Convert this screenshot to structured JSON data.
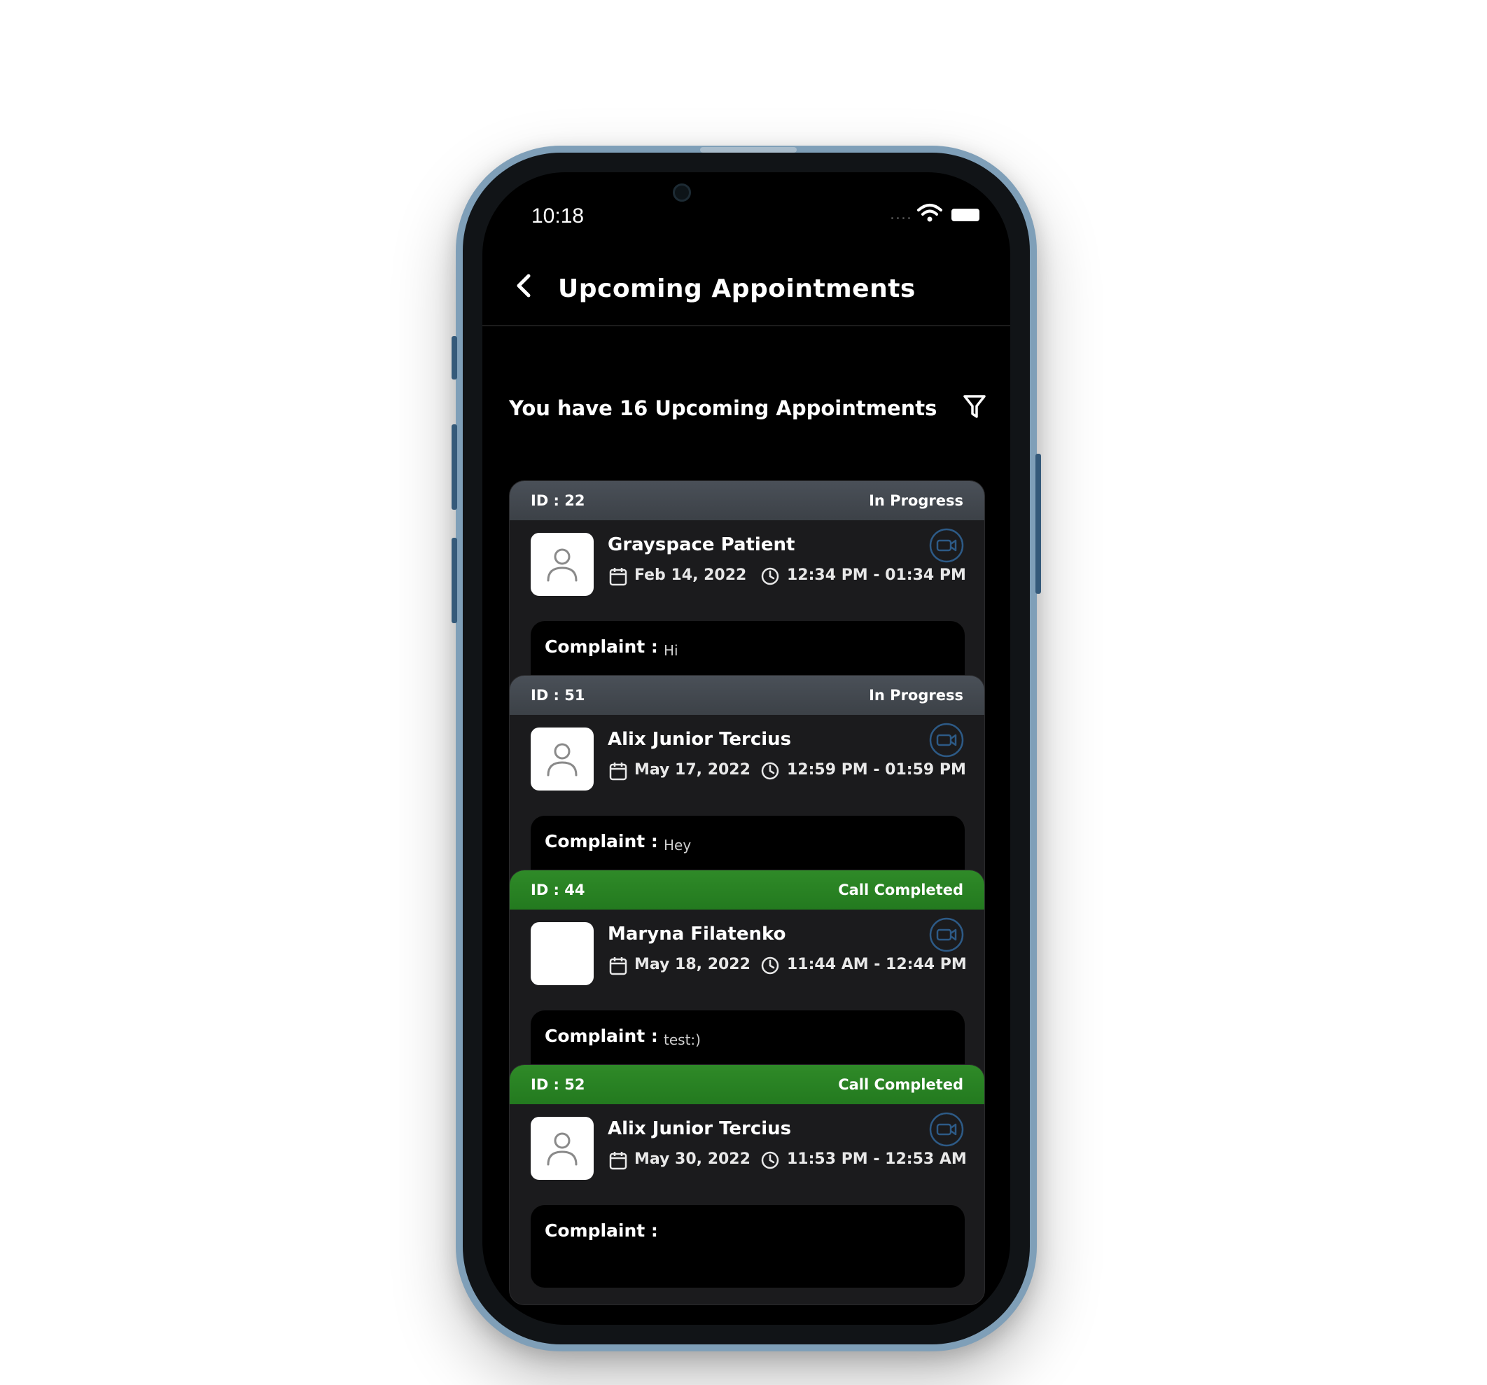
{
  "status_bar": {
    "time": "10:18",
    "signal": "....",
    "wifi_icon": "wifi-icon",
    "battery_icon": "battery-icon"
  },
  "header": {
    "back_icon": "chevron-left-icon",
    "title": "Upcoming Appointments"
  },
  "summary": {
    "text": "You have 16 Upcoming Appointments",
    "filter_icon": "filter-icon"
  },
  "colors": {
    "in_progress": "#41464d",
    "call_completed": "#2a8324",
    "background": "#000000",
    "card": "#1b1b1d"
  },
  "appointments": [
    {
      "id": "ID : 22",
      "status": "In Progress",
      "status_kind": "progress",
      "name": "Grayspace Patient",
      "date": "Feb 14, 2022",
      "time": "12:34 PM - 01:34 PM",
      "complaint_label": "Complaint :",
      "complaint": "Hi",
      "avatar": "user-placeholder-icon"
    },
    {
      "id": "ID : 51",
      "status": "In Progress",
      "status_kind": "progress",
      "name": "Alix Junior Tercius",
      "date": "May 17, 2022",
      "time": "12:59 PM - 01:59 PM",
      "complaint_label": "Complaint :",
      "complaint": "Hey",
      "avatar": "user-placeholder-icon"
    },
    {
      "id": "ID : 44",
      "status": "Call Completed",
      "status_kind": "completed",
      "name": "Maryna Filatenko",
      "date": "May 18, 2022",
      "time": "11:44 AM - 12:44 PM",
      "complaint_label": "Complaint :",
      "complaint": "test:)",
      "avatar": "blank-avatar"
    },
    {
      "id": "ID : 52",
      "status": "Call Completed",
      "status_kind": "completed",
      "name": "Alix Junior Tercius",
      "date": "May 30, 2022",
      "time": "11:53 PM - 12:53 AM",
      "complaint_label": "Complaint :",
      "complaint": "",
      "avatar": "user-placeholder-icon"
    }
  ]
}
